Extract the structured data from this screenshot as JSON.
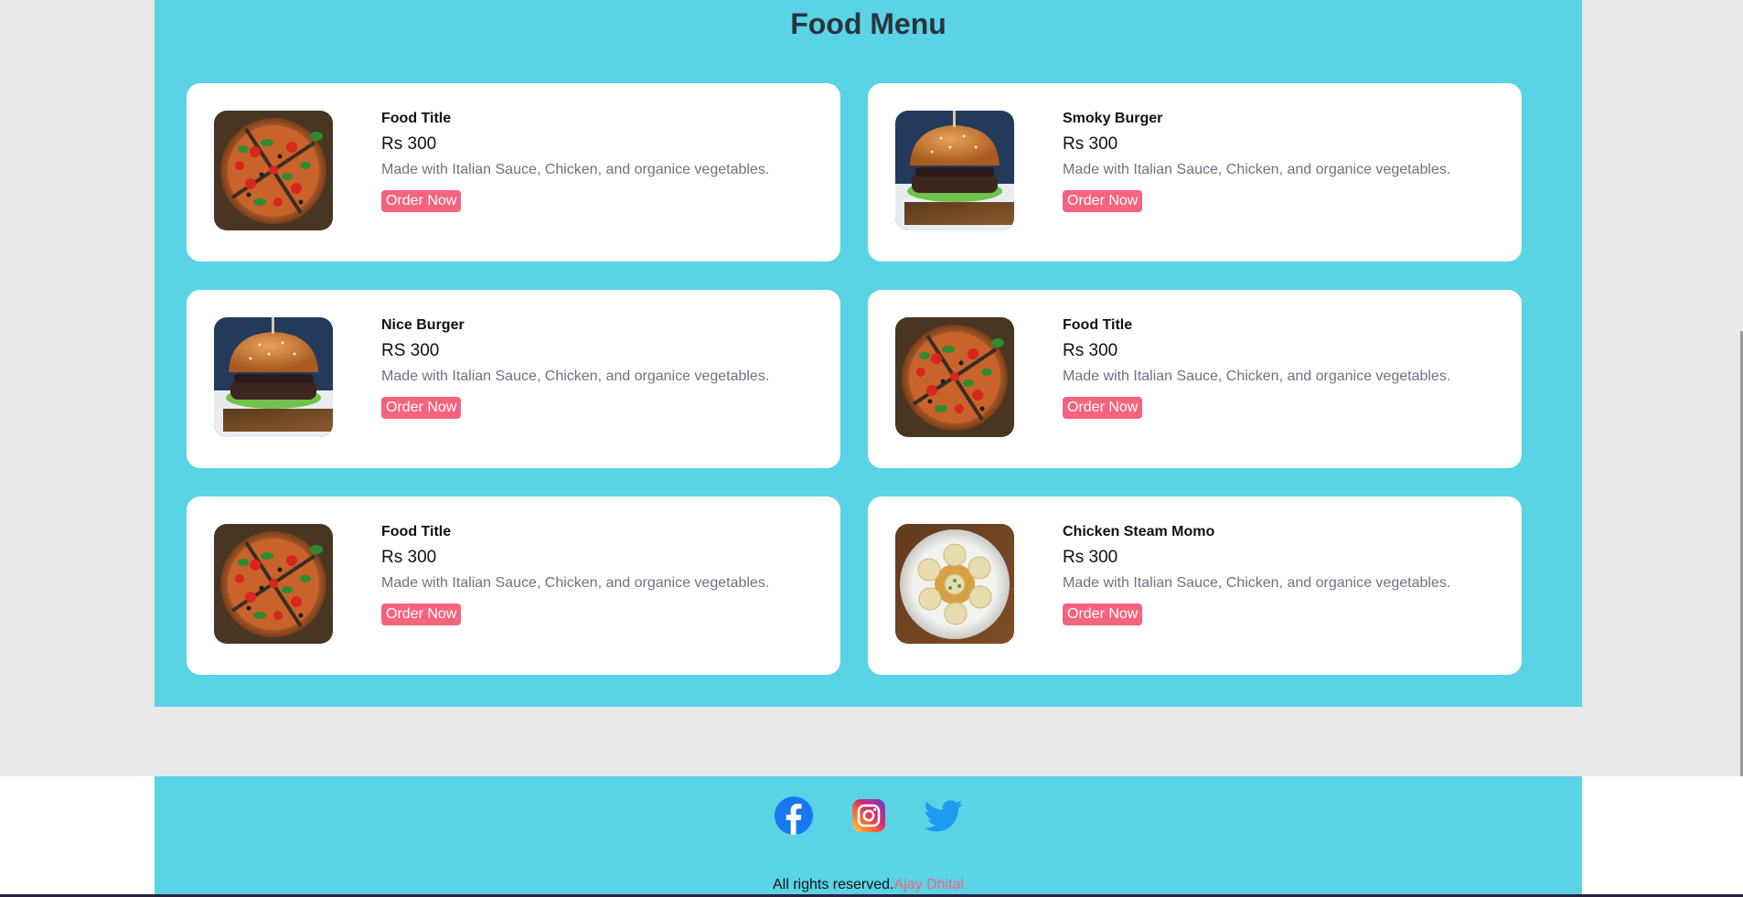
{
  "menu": {
    "title": "Food Menu",
    "items": [
      {
        "title": "Food Title",
        "price": "Rs 300",
        "description": "Made with Italian Sauce, Chicken, and organice vegetables.",
        "button": "Order Now",
        "image": "pizza"
      },
      {
        "title": "Smoky Burger",
        "price": "Rs 300",
        "description": "Made with Italian Sauce, Chicken, and organice vegetables.",
        "button": "Order Now",
        "image": "burger"
      },
      {
        "title": "Nice Burger",
        "price": "RS 300",
        "description": "Made with Italian Sauce, Chicken, and organice vegetables.",
        "button": "Order Now",
        "image": "burger"
      },
      {
        "title": "Food Title",
        "price": "Rs 300",
        "description": "Made with Italian Sauce, Chicken, and organice vegetables.",
        "button": "Order Now",
        "image": "pizza"
      },
      {
        "title": "Food Title",
        "price": "Rs 300",
        "description": "Made with Italian Sauce, Chicken, and organice vegetables.",
        "button": "Order Now",
        "image": "pizza"
      },
      {
        "title": "Chicken Steam Momo",
        "price": "Rs 300",
        "description": "Made with Italian Sauce, Chicken, and organice vegetables.",
        "button": "Order Now",
        "image": "momo"
      }
    ]
  },
  "footer": {
    "social": [
      "facebook-icon",
      "instagram-icon",
      "twitter-icon"
    ],
    "copyright": "All rights reserved.",
    "author": "Ajay Dhital"
  },
  "colors": {
    "section_bg": "#5ad3e5",
    "page_bg": "#e9e9e9",
    "accent": "#f5647e",
    "title": "#2a3440"
  }
}
